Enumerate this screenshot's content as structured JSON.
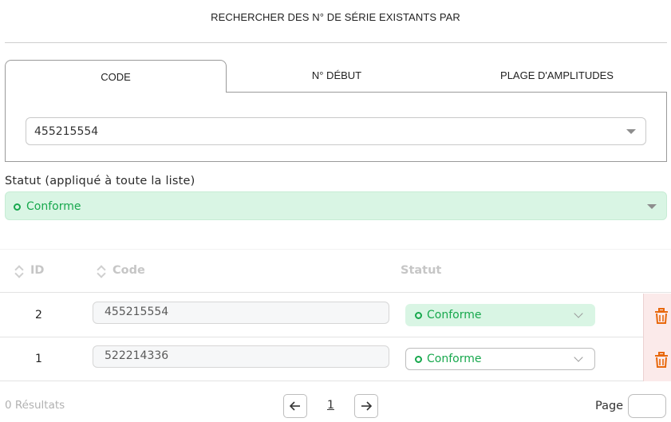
{
  "header": {
    "title": "RECHERCHER DES N° DE SÉRIE EXISTANTS PAR"
  },
  "tabs": [
    {
      "label": "CODE",
      "active": true
    },
    {
      "label": "N° DÉBUT",
      "active": false
    },
    {
      "label": "PLAGE D'AMPLITUDES",
      "active": false
    }
  ],
  "code_select": {
    "value": "455215554"
  },
  "status": {
    "label": "Statut (appliqué à toute la liste)",
    "value": "Conforme",
    "color": "#17a84d",
    "background": "#d9f5e4"
  },
  "table": {
    "columns": {
      "id": "ID",
      "code": "Code",
      "status": "Statut"
    },
    "rows": [
      {
        "id": "2",
        "code": "455215554",
        "status": "Conforme",
        "status_style": "filled"
      },
      {
        "id": "1",
        "code": "522214336",
        "status": "Conforme",
        "status_style": "outlined"
      }
    ],
    "delete_color": "#e8680c"
  },
  "footer": {
    "results": "0 Résultats",
    "current_page": "1",
    "page_label": "Page",
    "page_input_value": ""
  }
}
